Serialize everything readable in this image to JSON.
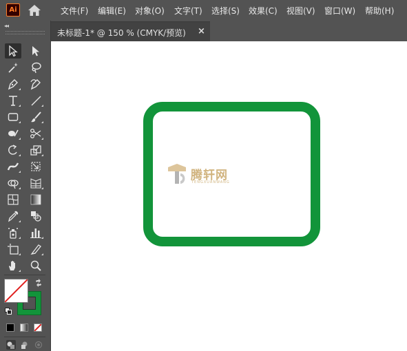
{
  "app": {
    "logo_text": "Ai",
    "home_icon": "home-icon"
  },
  "menu": [
    "文件(F)",
    "编辑(E)",
    "对象(O)",
    "文字(T)",
    "选择(S)",
    "效果(C)",
    "视图(V)",
    "窗口(W)",
    "帮助(H)"
  ],
  "tab": {
    "label": "未标题-1* @ 150 % (CMYK/预览)",
    "close": "×"
  },
  "toolbar": {
    "collapse": "◂◂",
    "tools": [
      "selection-tool-icon",
      "direct-selection-tool-icon",
      "magic-wand-tool-icon",
      "lasso-tool-icon",
      "pen-tool-icon",
      "curvature-tool-icon",
      "type-tool-icon",
      "line-segment-tool-icon",
      "rectangle-tool-icon",
      "paintbrush-tool-icon",
      "shaper-tool-icon",
      "scissors-tool-icon",
      "rotate-tool-icon",
      "scale-tool-icon",
      "width-tool-icon",
      "free-transform-tool-icon",
      "shape-builder-tool-icon",
      "perspective-grid-tool-icon",
      "mesh-tool-icon",
      "gradient-tool-icon",
      "eyedropper-tool-icon",
      "blend-tool-icon",
      "symbol-sprayer-tool-icon",
      "column-graph-tool-icon",
      "artboard-tool-icon",
      "slice-tool-icon",
      "hand-tool-icon",
      "zoom-tool-icon"
    ],
    "fill_color": "#ffffff",
    "stroke_color": "#12943a"
  },
  "canvas": {
    "shape_stroke_color": "#12943a",
    "watermark": {
      "text": "腾轩网",
      "subtext": "TENGXUANWANG"
    }
  }
}
